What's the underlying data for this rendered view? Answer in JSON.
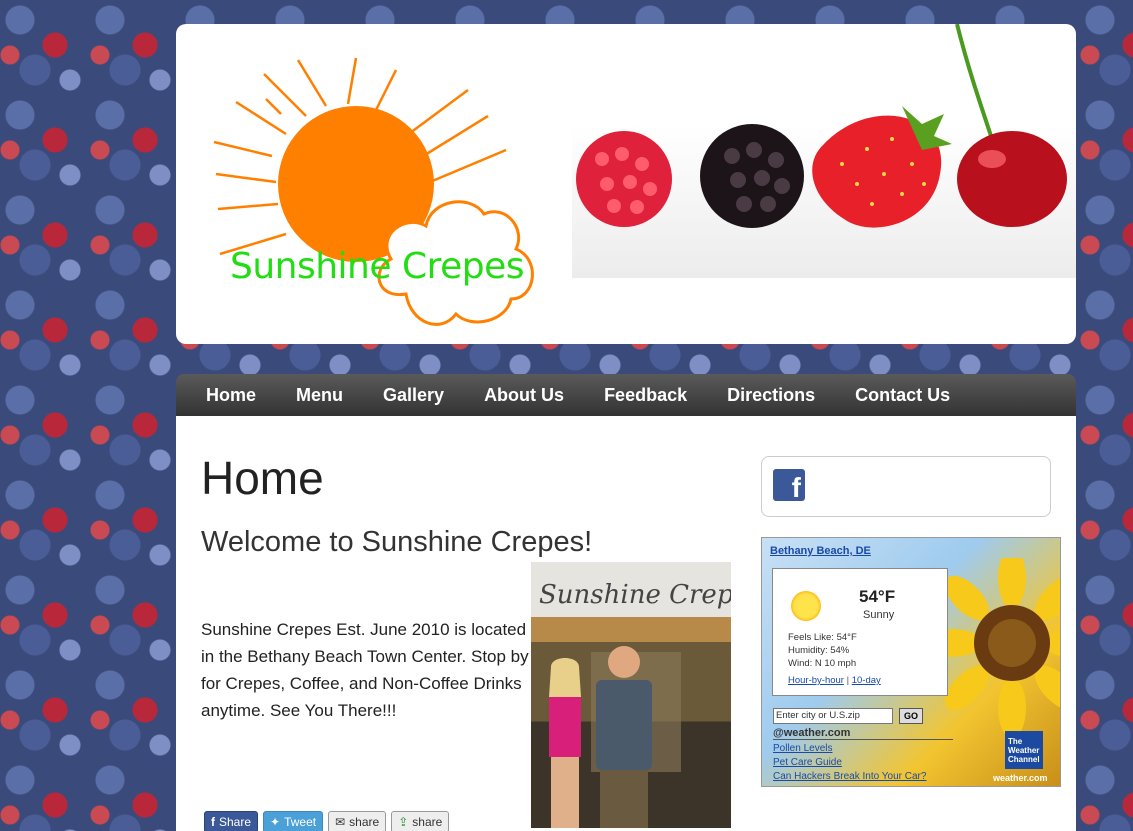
{
  "header": {
    "logo_text": "Sunshine Crepes"
  },
  "nav": {
    "items": [
      "Home",
      "Menu",
      "Gallery",
      "About Us",
      "Feedback",
      "Directions",
      "Contact Us"
    ]
  },
  "main": {
    "title": "Home",
    "welcome": "Welcome to Sunshine Crepes!",
    "intro": "Sunshine Crepes Est. June 2010 is located in the Bethany Beach Town Center. Stop by for Crepes, Coffee, and Non-Coffee Drinks anytime. See You There!!!",
    "photo_sign": "Sunshine Crepes"
  },
  "share": {
    "facebook": "Share",
    "twitter": "Tweet",
    "email": "share",
    "generic": "share"
  },
  "sidebar": {
    "facebook_icon": "facebook-icon"
  },
  "weather": {
    "location": "Bethany Beach, DE",
    "temperature": "54°F",
    "condition": "Sunny",
    "feels_like": "Feels Like: 54°F",
    "humidity": "Humidity: 54%",
    "wind": "Wind: N 10 mph",
    "link_hourly": "Hour-by-hour",
    "link_separator": "|",
    "link_10day": "10-day",
    "search_placeholder": "Enter city or U.S.zip",
    "go_label": "GO",
    "brand": "@weather.com",
    "promos": [
      "Pollen Levels",
      "Pet Care Guide",
      "Can Hackers Break Into Your Car?"
    ],
    "logo_line1": "The",
    "logo_line2": "Weather",
    "logo_line3": "Channel",
    "url": "weather.com"
  },
  "colors": {
    "logo_green": "#22dd11",
    "sun_orange": "#ff8000",
    "nav_bg": "#444444",
    "link_blue": "#1a4aa8"
  }
}
